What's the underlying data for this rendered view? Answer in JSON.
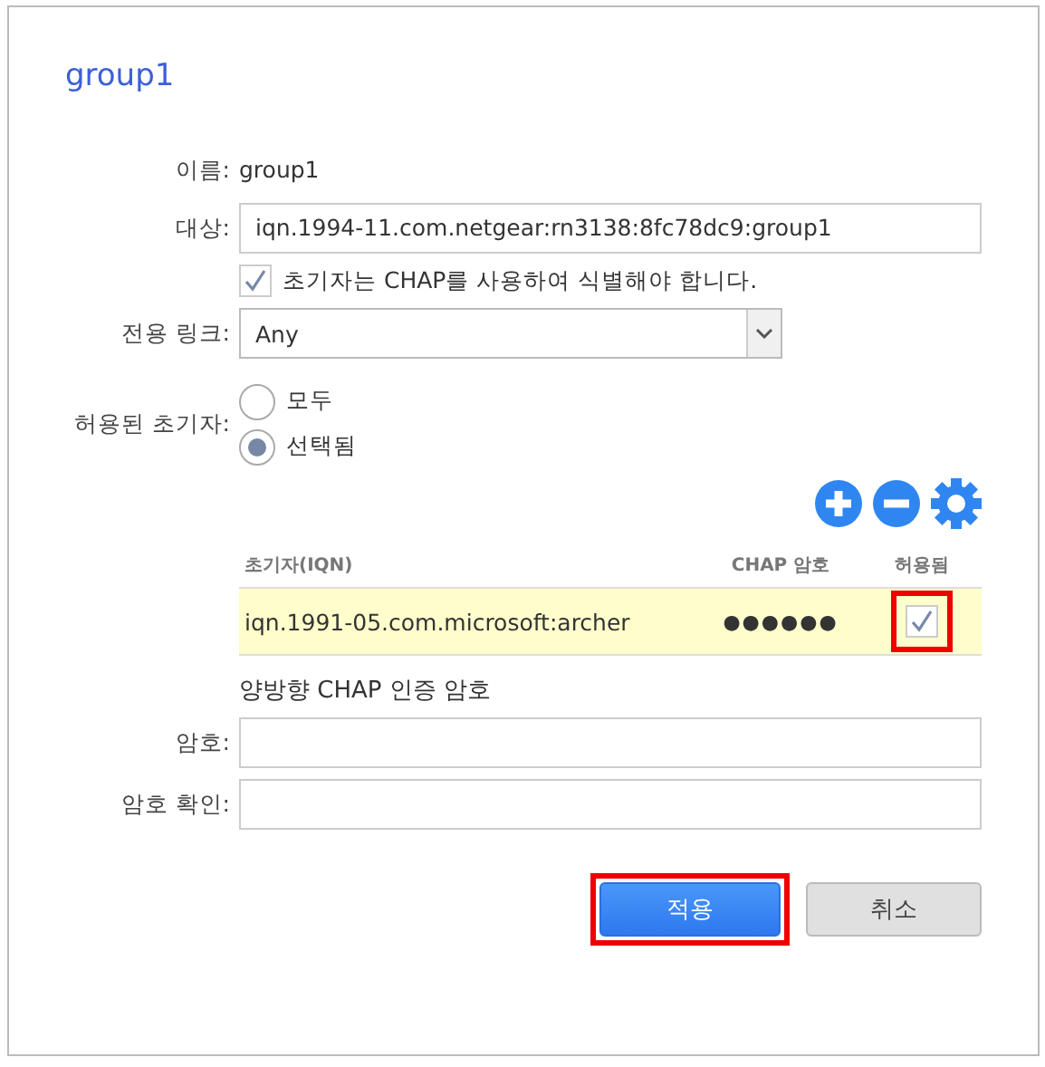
{
  "dialog": {
    "title": "group1",
    "name": {
      "label": "이름:",
      "value": "group1"
    },
    "target": {
      "label": "대상:",
      "value": "iqn.1994-11.com.netgear:rn3138:8fc78dc9:group1"
    },
    "chap_required": {
      "label": "초기자는 CHAP를 사용하여 식별해야 합니다.",
      "checked": true
    },
    "link": {
      "label": "전용 링크:",
      "value": "Any"
    },
    "initiators": {
      "label": "허용된 초기자:",
      "options": [
        {
          "label": "모두",
          "selected": false
        },
        {
          "label": "선택됨",
          "selected": true
        }
      ]
    },
    "table": {
      "columns": [
        "초기자(IQN)",
        "CHAP 암호",
        "허용됨"
      ],
      "rows": [
        {
          "iqn": "iqn.1991-05.com.microsoft:archer",
          "chap": "●●●●●●",
          "allowed": true,
          "highlighted": true
        }
      ]
    },
    "mutual_chap": {
      "title": "양방향 CHAP 인증 암호",
      "fields": [
        {
          "label": "암호:"
        },
        {
          "label": "암호 확인:"
        }
      ]
    },
    "buttons": [
      {
        "label": "적용",
        "kind": "primary",
        "highlighted": true
      },
      {
        "label": "취소",
        "kind": "secondary",
        "highlighted": false
      }
    ]
  }
}
